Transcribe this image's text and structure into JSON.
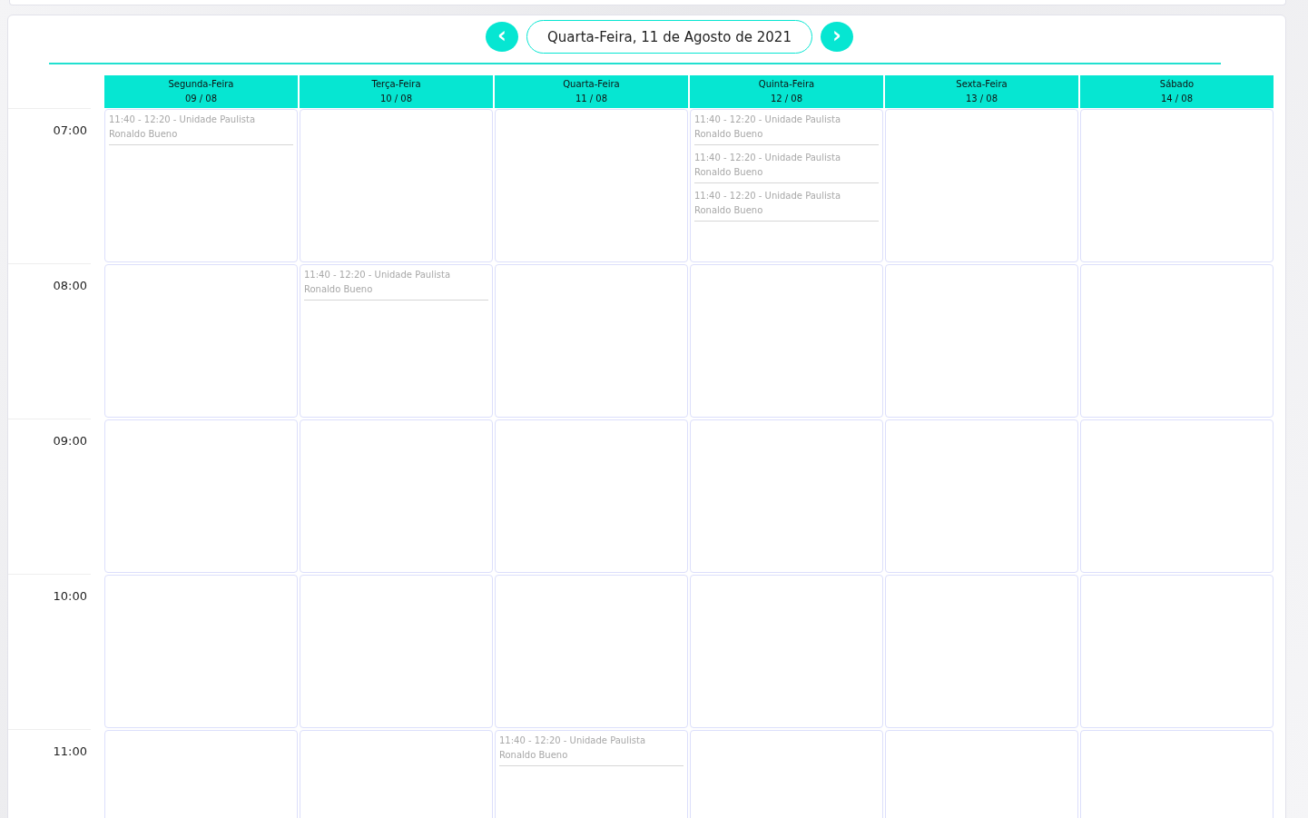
{
  "navigation": {
    "previous": "‹",
    "date": "Quarta-Feira, 11 de Agosto de 2021",
    "next": "›"
  },
  "days": [
    {
      "weekday": "Segunda-Feira",
      "date": "09 / 08"
    },
    {
      "weekday": "Terça-Feira",
      "date": "10 / 08"
    },
    {
      "weekday": "Quarta-Feira",
      "date": "11 / 08"
    },
    {
      "weekday": "Quinta-Feira",
      "date": "12 / 08"
    },
    {
      "weekday": "Sexta-Feira",
      "date": "13 / 08"
    },
    {
      "weekday": "Sábado",
      "date": "14 / 08"
    }
  ],
  "hours": [
    {
      "label": "07:00",
      "cells": [
        [
          {
            "time": "11:40 - 12:20 - Unidade Paulista",
            "name": "Ronaldo Bueno"
          }
        ],
        [],
        [],
        [
          {
            "time": "11:40 - 12:20 - Unidade Paulista",
            "name": "Ronaldo Bueno"
          },
          {
            "time": "11:40 - 12:20 - Unidade Paulista",
            "name": "Ronaldo Bueno"
          },
          {
            "time": "11:40 - 12:20 - Unidade Paulista",
            "name": "Ronaldo Bueno"
          }
        ],
        [],
        []
      ]
    },
    {
      "label": "08:00",
      "cells": [
        [],
        [
          {
            "time": "11:40 - 12:20 - Unidade Paulista",
            "name": "Ronaldo Bueno"
          }
        ],
        [],
        [],
        [],
        []
      ]
    },
    {
      "label": "09:00",
      "cells": [
        [],
        [],
        [],
        [],
        [],
        []
      ]
    },
    {
      "label": "10:00",
      "cells": [
        [],
        [],
        [],
        [],
        [],
        []
      ]
    },
    {
      "label": "11:00",
      "cells": [
        [],
        [],
        [
          {
            "time": "11:40 - 12:20 - Unidade Paulista",
            "name": "Ronaldo Bueno"
          }
        ],
        [],
        [],
        []
      ]
    }
  ]
}
